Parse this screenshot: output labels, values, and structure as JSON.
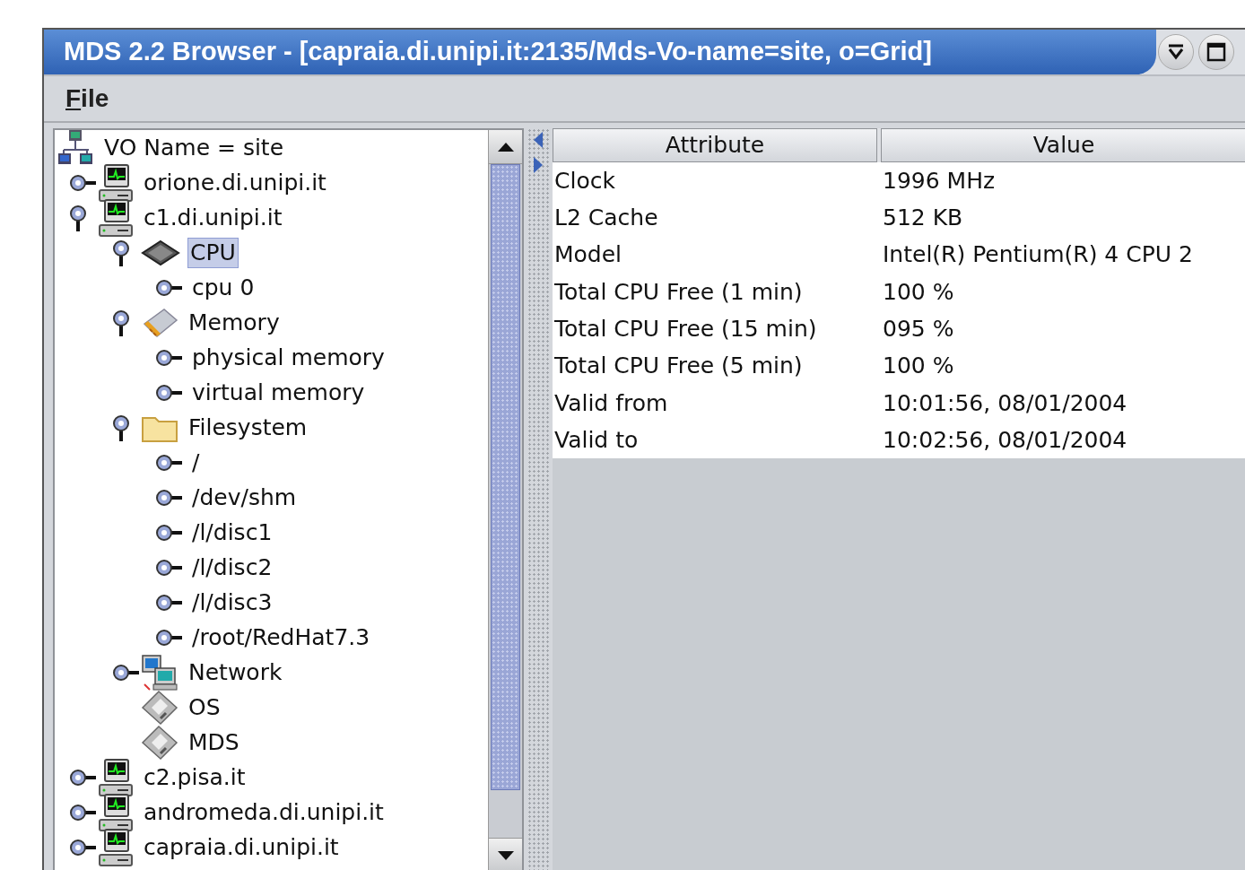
{
  "window": {
    "title": "MDS 2.2 Browser - [capraia.di.unipi.it:2135/Mds-Vo-name=site, o=Grid]"
  },
  "menu": [
    {
      "label": "File"
    }
  ],
  "tree": {
    "label": "VO Name = site",
    "kind": "root",
    "selected": false,
    "children": [
      {
        "label": "orione.di.unipi.it",
        "kind": "host",
        "expanded": false,
        "selected": false
      },
      {
        "label": "c1.di.unipi.it",
        "kind": "host",
        "expanded": true,
        "selected": false,
        "children": [
          {
            "label": "CPU",
            "kind": "chip",
            "expanded": true,
            "selected": true,
            "children": [
              {
                "label": "cpu 0",
                "expanded": false,
                "selected": false
              }
            ]
          },
          {
            "label": "Memory",
            "kind": "memory",
            "expanded": true,
            "selected": false,
            "children": [
              {
                "label": "physical memory",
                "expanded": false,
                "selected": false
              },
              {
                "label": "virtual memory",
                "expanded": false,
                "selected": false
              }
            ]
          },
          {
            "label": "Filesystem",
            "kind": "folder",
            "expanded": true,
            "selected": false,
            "children": [
              {
                "label": "/",
                "expanded": false,
                "selected": false
              },
              {
                "label": "/dev/shm",
                "expanded": false,
                "selected": false
              },
              {
                "label": "/l/disc1",
                "expanded": false,
                "selected": false
              },
              {
                "label": "/l/disc2",
                "expanded": false,
                "selected": false
              },
              {
                "label": "/l/disc3",
                "expanded": false,
                "selected": false
              },
              {
                "label": "/root/RedHat7.3",
                "expanded": false,
                "selected": false
              }
            ]
          },
          {
            "label": "Network",
            "kind": "network",
            "expanded": false,
            "selected": false
          },
          {
            "label": "OS",
            "kind": "disk",
            "selected": false
          },
          {
            "label": "MDS",
            "kind": "disk",
            "selected": false
          }
        ]
      },
      {
        "label": "c2.pisa.it",
        "kind": "host",
        "expanded": false,
        "selected": false
      },
      {
        "label": "andromeda.di.unipi.it",
        "kind": "host",
        "expanded": false,
        "selected": false
      },
      {
        "label": "capraia.di.unipi.it",
        "kind": "host",
        "expanded": false,
        "selected": false
      }
    ]
  },
  "table": {
    "columns": [
      "Attribute",
      "Value"
    ],
    "rows": [
      [
        "Clock",
        "1996 MHz"
      ],
      [
        "L2 Cache",
        "512 KB"
      ],
      [
        "Model",
        "Intel(R) Pentium(R) 4 CPU 2"
      ],
      [
        "Total CPU Free (1 min)",
        "100 %"
      ],
      [
        "Total CPU Free (15 min)",
        "095 %"
      ],
      [
        "Total CPU Free (5 min)",
        "100 %"
      ],
      [
        "Valid from",
        "10:01:56, 08/01/2004"
      ],
      [
        "Valid to",
        "10:02:56, 08/01/2004"
      ]
    ]
  }
}
